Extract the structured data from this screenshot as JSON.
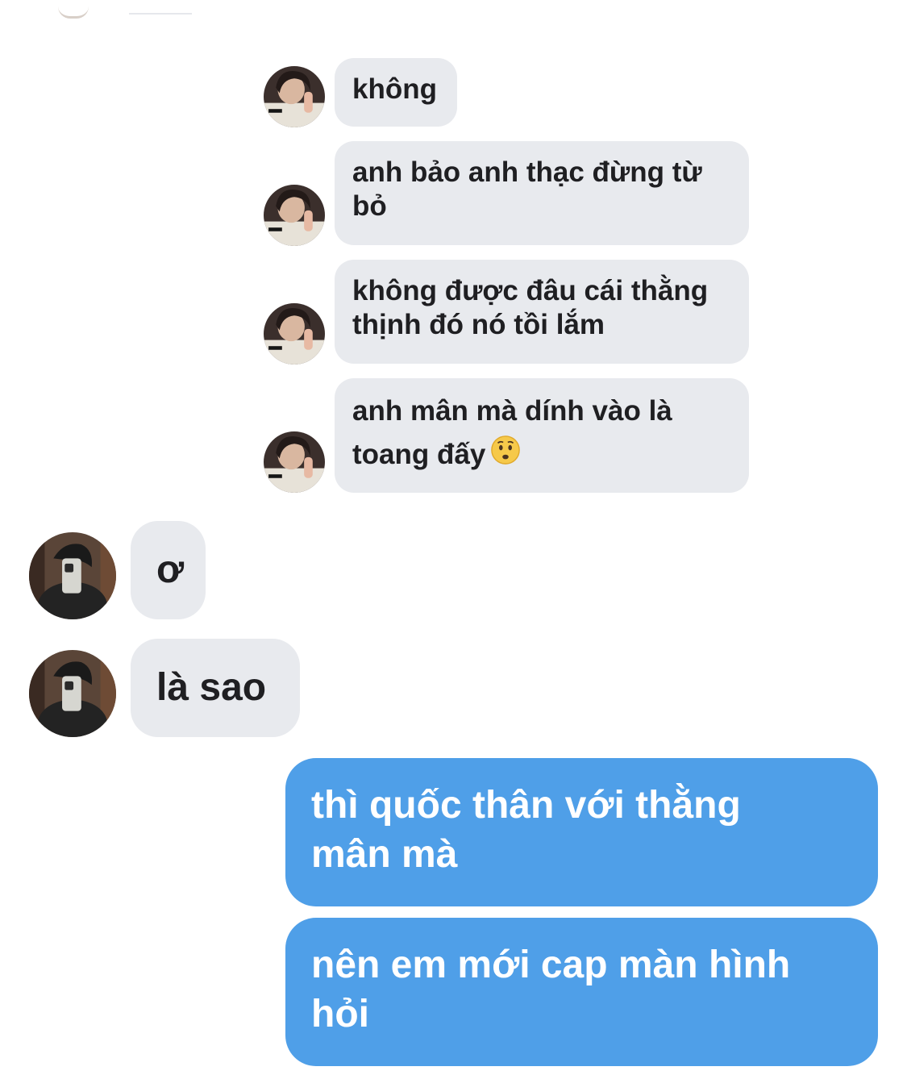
{
  "messages": [
    {
      "side": "incoming",
      "text_lines": [
        "không"
      ]
    },
    {
      "side": "incoming",
      "text_lines": [
        "anh bảo anh thạc đừng từ",
        "bỏ"
      ]
    },
    {
      "side": "incoming",
      "text_lines": [
        "không được đâu cái thằng",
        "thịnh đó nó tồi lắm"
      ]
    },
    {
      "side": "incoming",
      "text_lines": [
        "anh mân mà dính vào là",
        "toang đấy"
      ],
      "emoji": "worried-face-emoji"
    },
    {
      "side": "incoming",
      "text_lines": [
        "ơ"
      ]
    },
    {
      "side": "incoming",
      "text_lines": [
        "là sao"
      ]
    },
    {
      "side": "outgoing",
      "text_lines": [
        "thì quốc thân với thằng",
        "mân mà"
      ]
    },
    {
      "side": "outgoing",
      "text_lines": [
        "nên em mới cap màn hình",
        "hỏi"
      ]
    }
  ],
  "colors": {
    "incoming_bubble": "#e8eaee",
    "outgoing_bubble": "#4f9fe8",
    "outgoing_text": "#ffffff"
  },
  "icons": {
    "contact_a_avatar": "person-photo-thumbs-up",
    "contact_b_avatar": "person-photo-mirror-selfie"
  }
}
